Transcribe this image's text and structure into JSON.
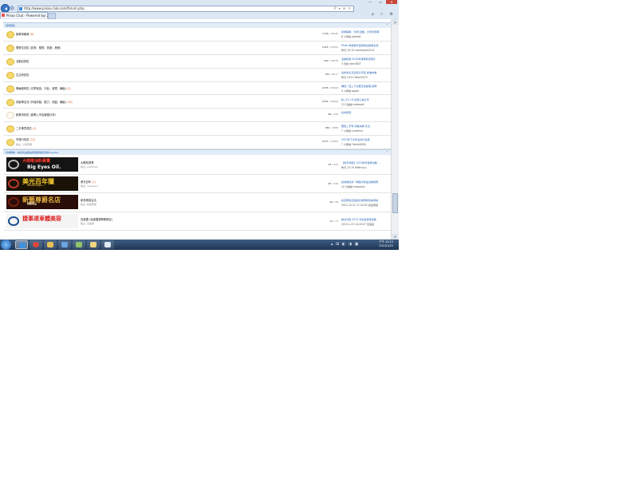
{
  "browser": {
    "url": "http://www.pinao.club.com/forum.php",
    "tab_title": "Pinao Club - Powered by ...",
    "tab_close": "×",
    "address_buttons": "P ▾ ⟳ ×",
    "toolbar_icons": "⌂ ☆ ⚙",
    "window_controls": [
      "—",
      "▭",
      "✕"
    ]
  },
  "breadcrumb": "…",
  "sections": [
    {
      "title": "俱樂部區",
      "collapse": "⌃"
    },
    {
      "title": "商城購物（本區商品經由俱樂部審核會員Suppler)",
      "collapse": "⌃"
    }
  ],
  "forums": [
    {
      "name": "新鮮事報導",
      "new": " (6)",
      "mod": "",
      "count": "1726",
      "posts": "18438",
      "last_title": "新鮮事報 「新年活動」大家會到哪",
      "last_meta": "8 小時前 pibeest",
      "active": true
    },
    {
      "name": "閒聊交流區 (影音、寵物、旅遊、美食)",
      "new": "",
      "mod": "",
      "count": "1425",
      "posts": "23252",
      "last_title": "Pinao 俱樂部年度聚餐活動報名表",
      "last_meta": "昨天 20:10 voicesport2014",
      "active": true
    },
    {
      "name": "活動紀錄區",
      "new": "",
      "mod": "",
      "count": "309",
      "posts": "14678",
      "last_title": "活動紀錄 2014年夏季聚會照片",
      "last_meta": "3 天前 atec0837",
      "active": true
    },
    {
      "name": "生活資訊區",
      "new": "",
      "mod": "",
      "count": "557",
      "posts": "8017",
      "last_title": "最新的生活資訊分享區 請進來看",
      "last_meta": "昨天 23:01 Niker9472",
      "active": true
    },
    {
      "name": "車輛維修區 (引擎保養、冷氣、音響、輪胎)",
      "new": " (5)",
      "mod": "",
      "count": "2235",
      "posts": "18206",
      "last_title": "轉速一直上不去要怎麼處理 請問",
      "last_meta": "4 小時前 apple",
      "active": true
    },
    {
      "name": "改裝車交流 (外觀改裝、動力、底盤、輪胎)",
      "new": " (16)",
      "mod": "",
      "count": "2301",
      "posts": "19060",
      "last_title": "新二代 1.8 改裝心得分享",
      "last_meta": "13 分鐘前 sidewalk",
      "active": true
    },
    {
      "name": "新車資訊區 (新車上市及報價分享)",
      "new": "",
      "mod": "",
      "count": "66",
      "posts": "530",
      "last_title": "從未發表",
      "last_meta": "",
      "active": false
    },
    {
      "name": "二手車買賣區",
      "new": " (4)",
      "mod": "",
      "count": "481",
      "posts": "2486",
      "last_title": "要賣二手車 請進來看 售出",
      "last_meta": "7 小時前 sunshine",
      "active": true
    },
    {
      "name": "市場行情區",
      "new": " (12)",
      "mod": "版主: 小吳老師",
      "count": "4727",
      "posts": "11893",
      "last_title": "2013年下半年最新行情表",
      "last_meta": "7 小時前 Oolsie0828",
      "active": true
    }
  ],
  "sponsors": [
    {
      "name": "大眼睛潤滑",
      "new": "",
      "mod": "版主: pilotEyes",
      "count": "23",
      "posts": "223",
      "last_title": "【新年特價】2013新年優惠活動 ...",
      "last_meta": "昨天 22:19 kMercury",
      "banner": {
        "line1": "大眼睛油料專賣",
        "line2": "Big Eyes Oil."
      }
    },
    {
      "name": "美光百年",
      "new": " (1)",
      "mod": "版主: meguiars",
      "count": "95",
      "posts": "546",
      "last_title": "請來看最新一期美光產品活動優惠",
      "last_meta": "10 分鐘前 meguiars",
      "banner": {
        "line1": "美光百年獵",
        "line2": "www.megu..."
      }
    },
    {
      "name": "新藝尊爵名店",
      "new": "",
      "mod": "版主: 新藝尊爵",
      "count": "56",
      "posts": "98",
      "last_title": "新藝尊爵店面最新優惠車款說明請",
      "last_meta": "2012-12-31 11:24:32 新藝尊爵",
      "banner": {
        "line1": "新藝尊爵名店",
        "line2": "精緻車品"
      }
    },
    {
      "name": "迅速捷 (高速捷運車體美容)",
      "new": "",
      "mod": "版主: 迅速捷",
      "count": "13",
      "posts": "73",
      "last_title": "歡迎光臨 2013 年最新優惠活動",
      "last_meta": "2013-1-23 14:43:07 迅速捷",
      "banner": {
        "line1": "捷事達車體美容",
        "line2": ""
      }
    }
  ],
  "taskbar": {
    "apps": [
      "ie",
      "chrome",
      "explorer",
      "media",
      "game",
      "folder",
      "window"
    ],
    "tray": "▴ ⊞ ◐ ◑ ▣",
    "time": "下午 10:13",
    "date": "2013/1/23"
  },
  "colors": {
    "accent": "#2366a8",
    "new_count": "#e25b2c",
    "section_bg": "#e3edf8"
  }
}
